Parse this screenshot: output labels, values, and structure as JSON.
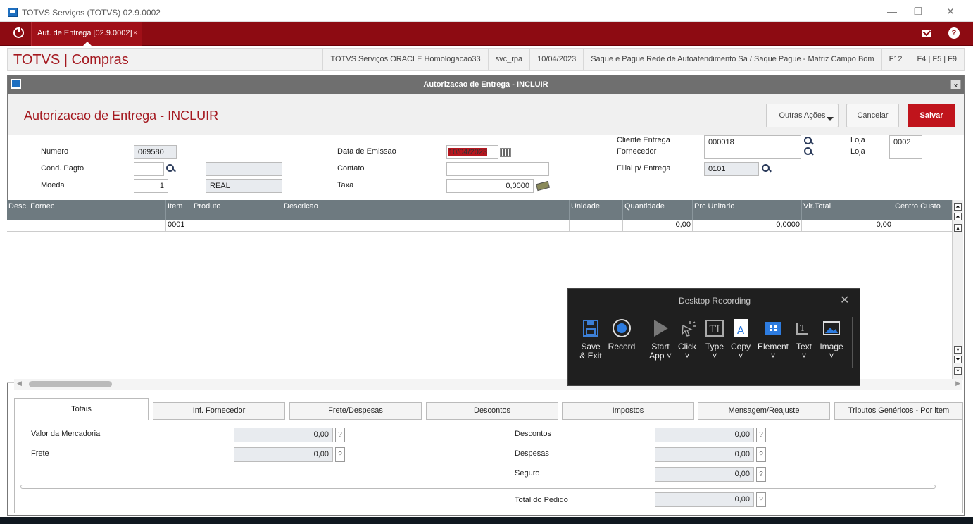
{
  "window": {
    "title": "TOTVS Serviços (TOTVS) 02.9.0002",
    "min": "—",
    "max": "❐",
    "close": "✕"
  },
  "tabbar": {
    "tab_label": "Aut. de Entrega [02.9.0002]",
    "tab_close": "×",
    "help": "?"
  },
  "infobar": {
    "brand": "TOTVS | Compras",
    "items": [
      "TOTVS Serviços ORACLE Homologacao33",
      "svc_rpa",
      "10/04/2023",
      "Saque e Pague Rede de Autoatendimento Sa / Saque Pague - Matriz Campo Bom",
      "F12",
      "F4 | F5 | F9"
    ]
  },
  "dialog": {
    "title": "Autorizacao de Entrega - INCLUIR",
    "close": "x",
    "page_title": "Autorizacao de Entrega - INCLUIR",
    "outras_acoes": "Outras Ações",
    "cancelar": "Cancelar",
    "salvar": "Salvar"
  },
  "form": {
    "numero_label": "Numero",
    "numero": "069580",
    "cond_pagto_label": "Cond. Pagto",
    "cond_pagto": "",
    "cond_pagto_desc": "",
    "moeda_label": "Moeda",
    "moeda": "1",
    "moeda_desc": "REAL",
    "data_emissao_label": "Data de Emissao",
    "data_emissao": "10/04/2023",
    "contato_label": "Contato",
    "contato": "",
    "taxa_label": "Taxa",
    "taxa": "0,0000",
    "cliente_entrega_label": "Cliente Entrega",
    "cliente_entrega": "000018",
    "fornecedor_label": "Fornecedor",
    "fornecedor": "",
    "filial_label": "Filial p/ Entrega",
    "filial": "0101",
    "loja1_label": "Loja",
    "loja1": "0002",
    "loja2_label": "Loja",
    "loja2": ""
  },
  "grid": {
    "columns": [
      "Desc. Fornec",
      "Item",
      "Produto",
      "Descricao",
      "Unidade",
      "Quantidade",
      "Prc Unitario",
      "Vlr.Total",
      "Centro Custo"
    ],
    "rows": [
      [
        "",
        "0001",
        "",
        "",
        "",
        "0,00",
        "0,0000",
        "0,00",
        ""
      ]
    ]
  },
  "tabs": [
    "Totais",
    "Inf. Fornecedor",
    "Frete/Despesas",
    "Descontos",
    "Impostos",
    "Mensagem/Reajuste",
    "Tributos Genéricos - Por item"
  ],
  "totais": {
    "valor_mercadoria_label": "Valor da Mercadoria",
    "valor_mercadoria": "0,00",
    "frete_label": "Frete",
    "frete": "0,00",
    "descontos_label": "Descontos",
    "descontos": "0,00",
    "despesas_label": "Despesas",
    "despesas": "0,00",
    "seguro_label": "Seguro",
    "seguro": "0,00",
    "total_label": "Total do Pedido",
    "total": "0,00",
    "help": "?"
  },
  "recorder": {
    "title": "Desktop Recording",
    "close": "✕",
    "tools": [
      {
        "line1": "Save",
        "line2": "& Exit"
      },
      {
        "line1": "Record",
        "line2": ""
      },
      {
        "line1": "Start",
        "line2": "App ˅"
      },
      {
        "line1": "Click",
        "line2": "˅"
      },
      {
        "line1": "Type",
        "line2": "˅"
      },
      {
        "line1": "Copy",
        "line2": "˅"
      },
      {
        "line1": "Element",
        "line2": "˅"
      },
      {
        "line1": "Text",
        "line2": "˅"
      },
      {
        "line1": "Image",
        "line2": "˅"
      }
    ]
  },
  "colors": {
    "brand": "#a4181f",
    "tabbar": "#8d0b12",
    "grid_header": "#6e7a80",
    "save_button": "#c0141c"
  }
}
